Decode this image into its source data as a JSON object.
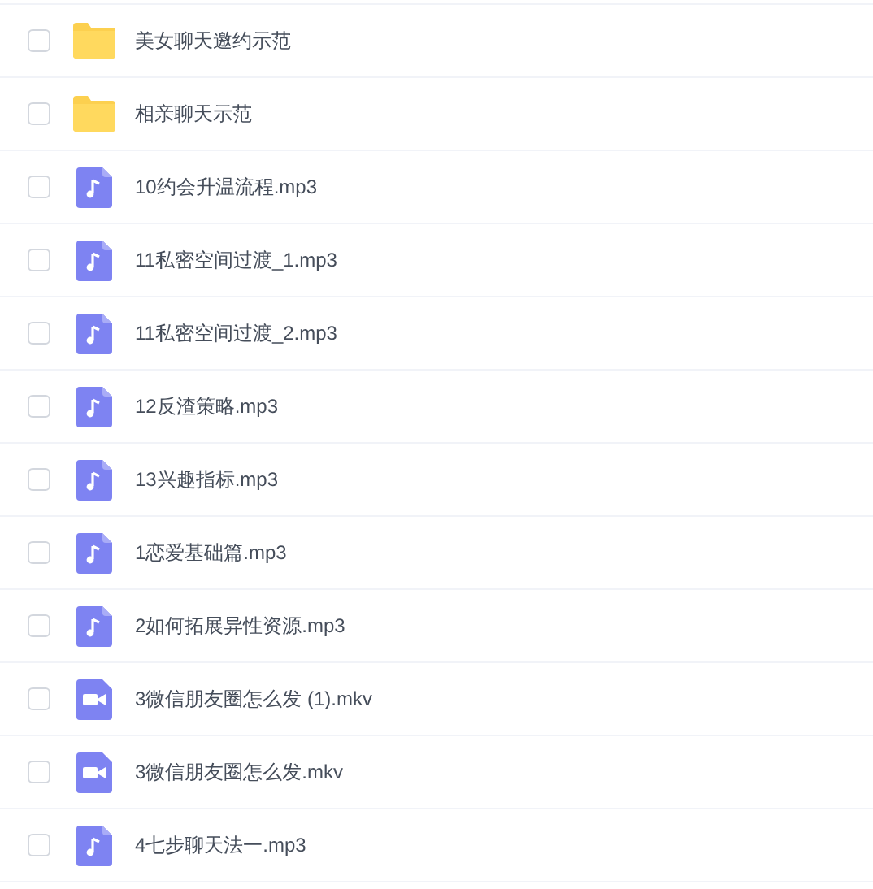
{
  "files": [
    {
      "kind": "folder",
      "name": "美女聊天邀约示范",
      "checked": false
    },
    {
      "kind": "folder",
      "name": "相亲聊天示范",
      "checked": false
    },
    {
      "kind": "audio",
      "name": "10约会升温流程.mp3",
      "checked": false
    },
    {
      "kind": "audio",
      "name": "11私密空间过渡_1.mp3",
      "checked": false
    },
    {
      "kind": "audio",
      "name": "11私密空间过渡_2.mp3",
      "checked": false
    },
    {
      "kind": "audio",
      "name": "12反渣策略.mp3",
      "checked": false
    },
    {
      "kind": "audio",
      "name": "13兴趣指标.mp3",
      "checked": false
    },
    {
      "kind": "audio",
      "name": "1恋爱基础篇.mp3",
      "checked": false
    },
    {
      "kind": "audio",
      "name": "2如何拓展异性资源.mp3",
      "checked": false
    },
    {
      "kind": "video",
      "name": "3微信朋友圈怎么发 (1).mkv",
      "checked": false
    },
    {
      "kind": "video",
      "name": "3微信朋友圈怎么发.mkv",
      "checked": false
    },
    {
      "kind": "audio",
      "name": "4七步聊天法一.mp3",
      "checked": false
    }
  ]
}
